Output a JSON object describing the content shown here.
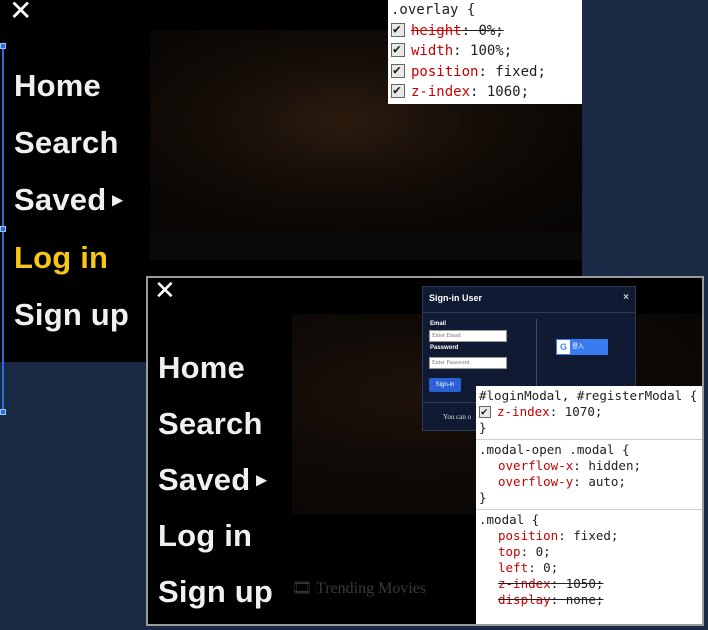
{
  "top": {
    "close_glyph": "✕",
    "nav": [
      "Home",
      "Search",
      "Saved",
      "Log in",
      "Sign up"
    ],
    "saved_caret": "▸",
    "overlay_panel": {
      "selector": ".overlay {",
      "declarations": [
        {
          "prop": "height",
          "value": "0%;",
          "strike": true
        },
        {
          "prop": "width",
          "value": "100%;",
          "strike": false
        },
        {
          "prop": "position",
          "value": "fixed;",
          "strike": false
        },
        {
          "prop": "z-index",
          "value": "1060;",
          "strike": false
        }
      ]
    }
  },
  "bottom": {
    "close_glyph": "✕",
    "nav": [
      "Home",
      "Search",
      "Saved",
      "Log in",
      "Sign up"
    ],
    "saved_caret": "▸",
    "trending": "🎞 Trending Movies",
    "modal": {
      "title": "Sign-in User",
      "close": "×",
      "email_label": "Email",
      "email_placeholder": "Enter Email",
      "password_label": "Password",
      "password_placeholder": "Enter Password",
      "signin_button": "Sign-in",
      "google_g": "G",
      "google_label": "登入",
      "footer": "You can o"
    },
    "rules_panel": {
      "rule1_selector": "#loginModal, #registerModal {",
      "rule1_decl": {
        "prop": "z-index",
        "value": "1070;"
      },
      "rule2_selector": ".modal-open .modal {",
      "rule2_decls": [
        {
          "prop": "overflow-x",
          "value": "hidden;"
        },
        {
          "prop": "overflow-y",
          "value": "auto;"
        }
      ],
      "rule3_selector": ".modal {",
      "rule3_decls": [
        {
          "prop": "position",
          "value": "fixed;",
          "strike": false
        },
        {
          "prop": "top",
          "value": "0;",
          "strike": false
        },
        {
          "prop": "left",
          "value": "0;",
          "strike": false
        },
        {
          "prop": "z-index",
          "value": "1050;",
          "strike": true
        },
        {
          "prop": "display",
          "value": "none;",
          "strike": true
        }
      ],
      "close_brace": "}"
    }
  }
}
